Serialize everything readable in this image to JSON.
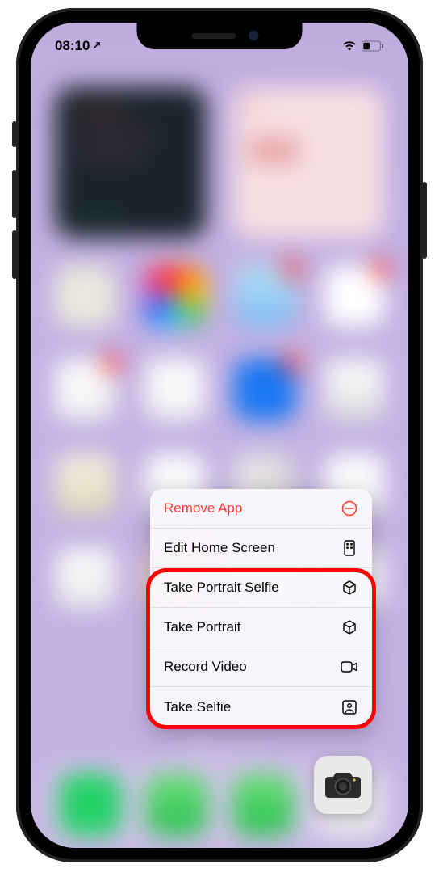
{
  "status": {
    "time": "08:10",
    "location_indicator": "↗"
  },
  "menu": {
    "items": [
      {
        "label": "Remove App",
        "icon": "minus-circle-icon",
        "destructive": true
      },
      {
        "label": "Edit Home Screen",
        "icon": "homescreen-icon",
        "destructive": false
      },
      {
        "label": "Take Portrait Selfie",
        "icon": "cube-icon",
        "destructive": false
      },
      {
        "label": "Take Portrait",
        "icon": "cube-icon",
        "destructive": false
      },
      {
        "label": "Record Video",
        "icon": "video-icon",
        "destructive": false
      },
      {
        "label": "Take Selfie",
        "icon": "person-square-icon",
        "destructive": false
      }
    ]
  },
  "highlighted_app": "Camera"
}
